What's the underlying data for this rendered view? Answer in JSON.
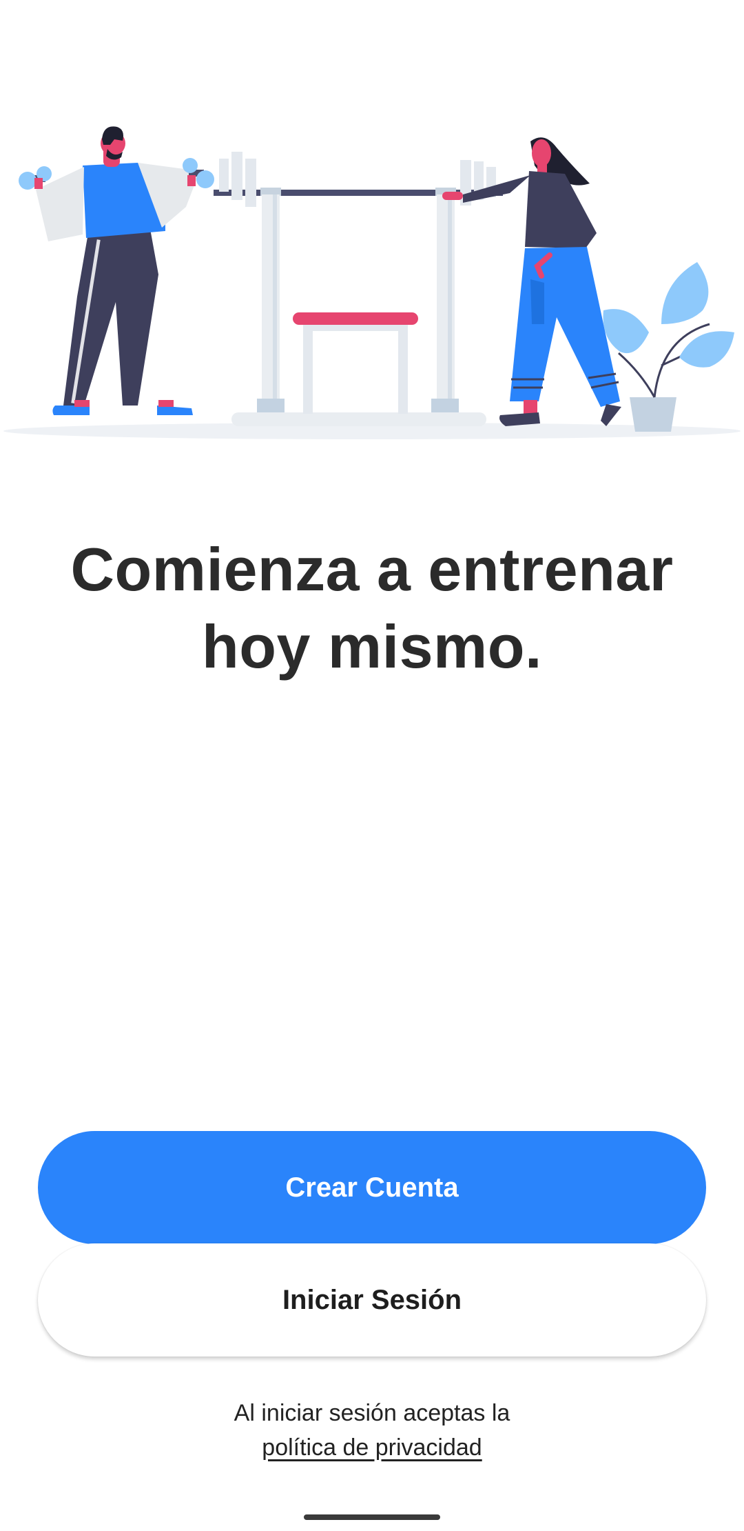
{
  "hero": {
    "illustration": "gym-workout-illustration"
  },
  "headline": {
    "line1": "Comienza a entrenar",
    "line2": "hoy mismo."
  },
  "actions": {
    "create_account_label": "Crear Cuenta",
    "login_label": "Iniciar Sesión"
  },
  "legal": {
    "text": "Al iniciar sesión aceptas la",
    "link_label": "política de privacidad"
  },
  "colors": {
    "primary": "#2a84fb",
    "dark": "#3e3f5c",
    "accent": "#e6456f",
    "light_blue": "#8ec9fb",
    "text": "#2b2b2b"
  }
}
